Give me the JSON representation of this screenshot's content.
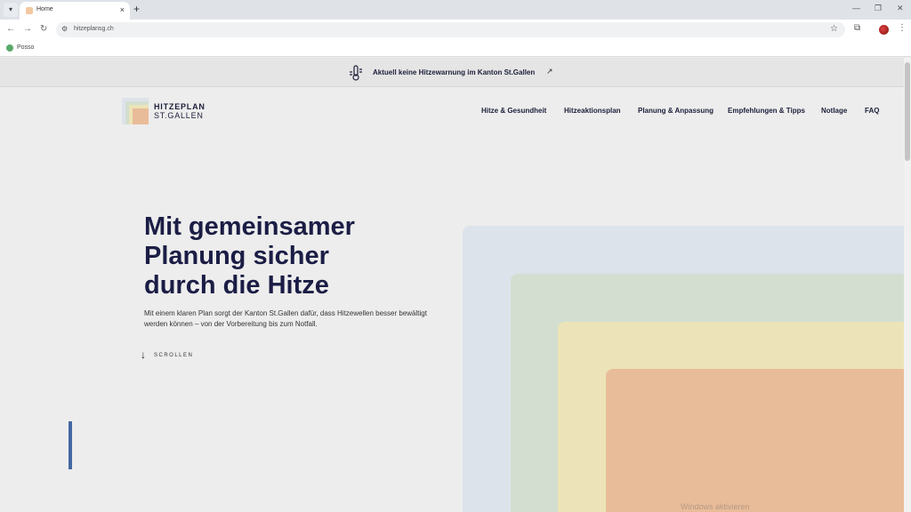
{
  "browser": {
    "tab_title": "Home",
    "tab_close": "×",
    "new_tab": "+",
    "menu_glyph": "▾",
    "url": "hitzeplansg.ch",
    "bookmark_label": "Posso",
    "icons": [
      "chevron-down-icon",
      "favicon-icon",
      "close-icon",
      "plus-icon",
      "back-arrow-icon",
      "forward-arrow-icon",
      "reload-icon",
      "site-settings-icon",
      "star-icon",
      "extensions-icon",
      "profile-icon",
      "kebab-menu-icon",
      "minimize-icon",
      "maximize-icon",
      "window-close-icon"
    ]
  },
  "banner": {
    "text": "Aktuell keine Hitzewarnung im Kanton St.Gallen",
    "icon": "thermometer-icon",
    "link_icon": "external-link-icon"
  },
  "logo": {
    "title": "HITZEPLAN",
    "subtitle": "ST.GALLEN",
    "colors": [
      "#dde3ea",
      "#d3ded0",
      "#ece4b8",
      "#e9bc99"
    ]
  },
  "nav": {
    "items": [
      {
        "label": "Hitze & Gesundheit"
      },
      {
        "label": "Hitzeaktionsplan"
      },
      {
        "label": "Planung & Anpassung"
      },
      {
        "label": "Empfehlungen & Tipps"
      },
      {
        "label": "Notlage"
      },
      {
        "label": "FAQ"
      }
    ]
  },
  "hero": {
    "title_line1": "Mit gemeinsamer",
    "title_line2": "Planung sicher",
    "title_line3": "durch die Hitze",
    "text": "Mit einem klaren Plan sorgt der Kanton St.Gallen dafür, dass Hitzewellen besser bewältigt werden können – von der Vorbereitung bis zum Notfall.",
    "scroll_label": "SCROLLEN",
    "scroll_arrow": "↓",
    "accent_color": "#4469a3"
  },
  "watermark": "Windows aktivieren"
}
